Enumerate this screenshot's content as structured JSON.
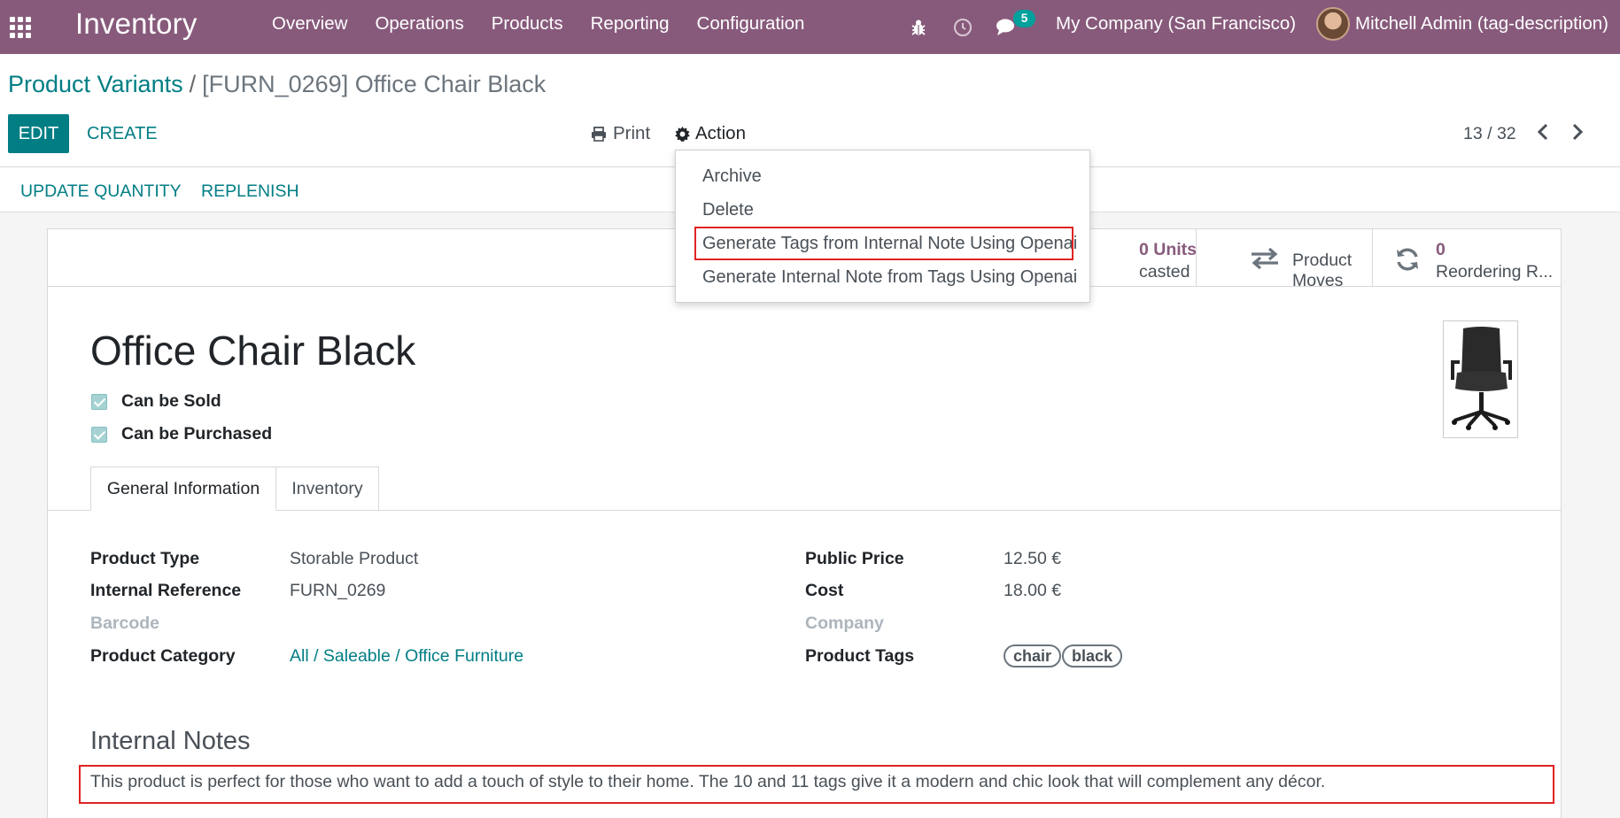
{
  "navbar": {
    "app_title": "Inventory",
    "menu": [
      "Overview",
      "Operations",
      "Products",
      "Reporting",
      "Configuration"
    ],
    "messages_count": "5",
    "company": "My Company (San Francisco)",
    "user": "Mitchell Admin (tag-description)",
    "icons": [
      "apps-icon",
      "bug-icon",
      "clock-icon",
      "chat-icon"
    ]
  },
  "breadcrumb": {
    "parent": "Product Variants",
    "separator": "/",
    "current": "[FURN_0269] Office Chair Black"
  },
  "control_panel": {
    "edit_label": "EDIT",
    "create_label": "CREATE",
    "print_label": "Print",
    "action_label": "Action",
    "pager": "13 / 32"
  },
  "action_menu": {
    "items": [
      "Archive",
      "Delete",
      "Generate Tags from Internal Note Using Openai",
      "Generate Internal Note from Tags Using Openai"
    ]
  },
  "statusbar": {
    "update_quantity": "UPDATE QUANTITY",
    "replenish": "REPLENISH"
  },
  "smart_buttons": {
    "forecast_value": "0 Units",
    "forecast_label": "casted",
    "moves_label": "Product Moves",
    "reorder_value": "0",
    "reorder_label": "Reordering R..."
  },
  "product": {
    "name": "Office Chair Black",
    "can_be_sold_label": "Can be Sold",
    "can_be_sold": true,
    "can_be_purchased_label": "Can be Purchased",
    "can_be_purchased": true
  },
  "tabs": [
    "General Information",
    "Inventory"
  ],
  "general_info": {
    "left": [
      {
        "label": "Product Type",
        "value": "Storable Product"
      },
      {
        "label": "Internal Reference",
        "value": "FURN_0269"
      },
      {
        "label": "Barcode",
        "value": ""
      },
      {
        "label": "Product Category",
        "value": "All / Saleable / Office Furniture"
      }
    ],
    "right": [
      {
        "label": "Public Price",
        "value": "12.50 €"
      },
      {
        "label": "Cost",
        "value": "18.00 €"
      },
      {
        "label": "Company",
        "value": ""
      },
      {
        "label": "Product Tags",
        "value": ""
      }
    ],
    "tags": [
      "chair",
      "black"
    ]
  },
  "notes": {
    "title": "Internal Notes",
    "text": "This product is perfect for those who want to add a touch of style to their home. The 10 and 11 tags give it a modern and chic look that will complement any décor."
  },
  "colors": {
    "navbar": "#875a7b",
    "accent": "#017e84",
    "badge": "#00a09d",
    "stat_value": "#875a7b",
    "highlight": "#e02424"
  }
}
